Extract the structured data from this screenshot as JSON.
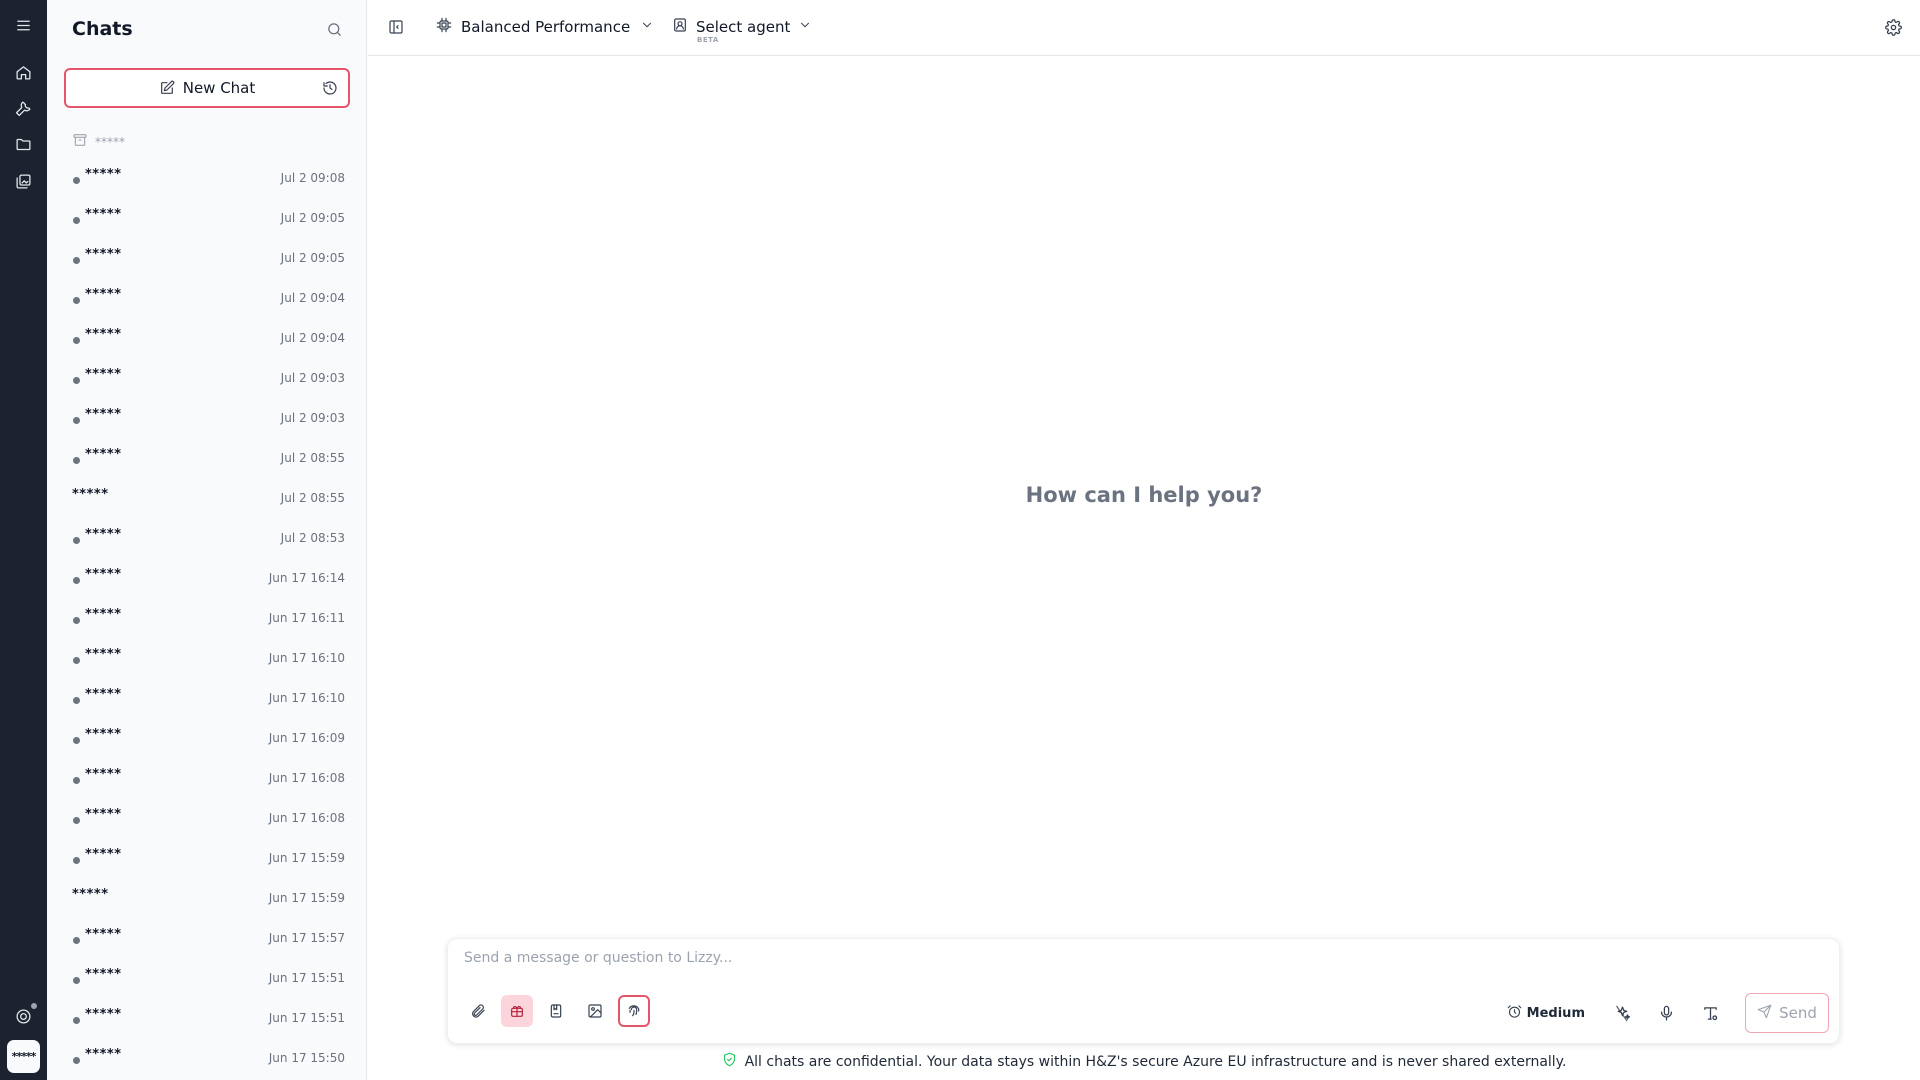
{
  "sidebar": {
    "title": "Chats",
    "new_chat_label": "New Chat",
    "archive_label": "*****",
    "chats": [
      {
        "name": "*****",
        "time": "Jul 2 09:08",
        "dot": true
      },
      {
        "name": "*****",
        "time": "Jul 2 09:05",
        "dot": true
      },
      {
        "name": "*****",
        "time": "Jul 2 09:05",
        "dot": true
      },
      {
        "name": "*****",
        "time": "Jul 2 09:04",
        "dot": true
      },
      {
        "name": "*****",
        "time": "Jul 2 09:04",
        "dot": true
      },
      {
        "name": "*****",
        "time": "Jul 2 09:03",
        "dot": true
      },
      {
        "name": "*****",
        "time": "Jul 2 09:03",
        "dot": true
      },
      {
        "name": "*****",
        "time": "Jul 2 08:55",
        "dot": true
      },
      {
        "name": "*****",
        "time": "Jul 2 08:55",
        "dot": false
      },
      {
        "name": "*****",
        "time": "Jul 2 08:53",
        "dot": true
      },
      {
        "name": "*****",
        "time": "Jun 17 16:14",
        "dot": true
      },
      {
        "name": "*****",
        "time": "Jun 17 16:11",
        "dot": true
      },
      {
        "name": "*****",
        "time": "Jun 17 16:10",
        "dot": true
      },
      {
        "name": "*****",
        "time": "Jun 17 16:10",
        "dot": true
      },
      {
        "name": "*****",
        "time": "Jun 17 16:09",
        "dot": true
      },
      {
        "name": "*****",
        "time": "Jun 17 16:08",
        "dot": true
      },
      {
        "name": "*****",
        "time": "Jun 17 16:08",
        "dot": true
      },
      {
        "name": "*****",
        "time": "Jun 17 15:59",
        "dot": true
      },
      {
        "name": "*****",
        "time": "Jun 17 15:59",
        "dot": false
      },
      {
        "name": "*****",
        "time": "Jun 17 15:57",
        "dot": true
      },
      {
        "name": "*****",
        "time": "Jun 17 15:51",
        "dot": true
      },
      {
        "name": "*****",
        "time": "Jun 17 15:51",
        "dot": true
      },
      {
        "name": "*****",
        "time": "Jun 17 15:50",
        "dot": true
      }
    ]
  },
  "rail": {
    "avatar_text": "*****",
    "icons": [
      "menu-icon",
      "home-icon",
      "wrench-icon",
      "folder-icon",
      "gallery-icon",
      "support-icon"
    ]
  },
  "topbar": {
    "model_label": "Balanced Performance",
    "agent_label": "Select agent",
    "agent_badge": "BETA"
  },
  "main": {
    "greeting": "How can I help you?"
  },
  "composer": {
    "placeholder": "Send a message or question to Lizzy...",
    "effort_label": "Medium",
    "send_label": "Send"
  },
  "footer": {
    "notice": "All chats are confidential. Your data stays within H&Z's secure Azure EU infrastructure and is never shared externally."
  },
  "colors": {
    "rail_bg": "#1c2230",
    "accent": "#e5566b",
    "active_tool_bg": "#fcd5dc",
    "shield_green": "#22c55e"
  }
}
